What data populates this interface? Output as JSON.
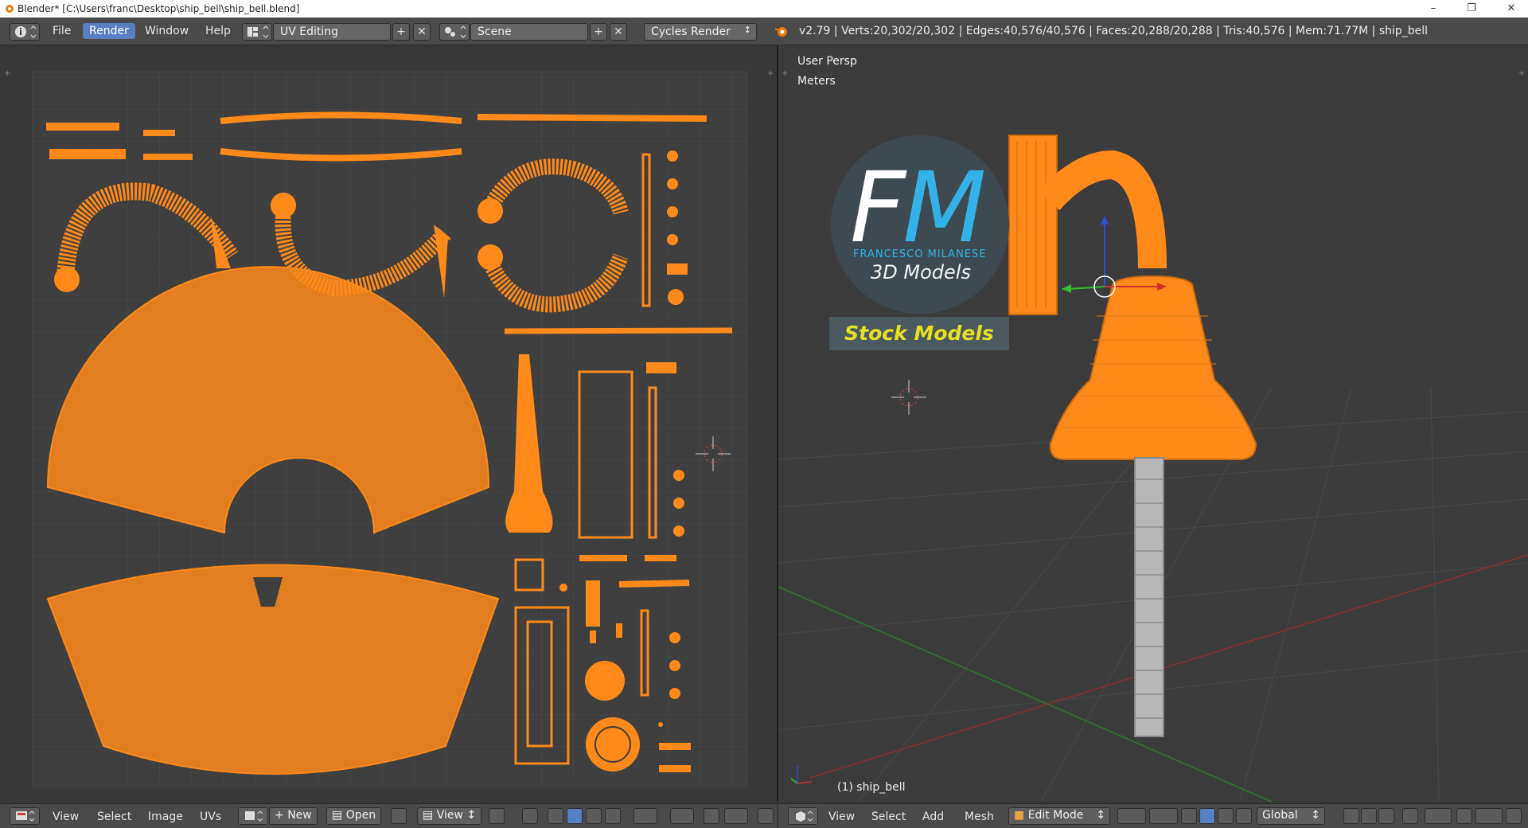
{
  "titlebar": {
    "title": "Blender* [C:\\Users\\franc\\Desktop\\ship_bell\\ship_bell.blend]",
    "icons": [
      "blender-icon",
      "minimize-icon",
      "restore-icon",
      "close-icon"
    ]
  },
  "infobar": {
    "menu": [
      "File",
      "Render",
      "Window",
      "Help"
    ],
    "active_menu": "Render",
    "screen_layout": "UV Editing",
    "scene": "Scene",
    "render_engine": "Cycles Render",
    "stats": "v2.79 | Verts:20,302/20,302 | Edges:40,576/40,576 | Faces:20,288/20,288 | Tris:40,576 | Mem:71.77M | ship_bell"
  },
  "uv_editor": {
    "header_menu": [
      "View",
      "Select",
      "Image",
      "UVs"
    ],
    "new_label": "New",
    "open_label": "Open",
    "view_label": "View"
  },
  "viewport": {
    "view_label": "User Persp",
    "units_label": "Meters",
    "object_label": "(1) ship_bell",
    "header_menu": [
      "View",
      "Select",
      "Add",
      "Mesh"
    ],
    "mode": "Edit Mode",
    "orientation": "Global"
  },
  "logo": {
    "fm": "FM",
    "name": "FRANCESCO MILANESE",
    "models": "3D Models",
    "stock": "Stock Models"
  },
  "colors": {
    "uv_orange": "#ff8a1a",
    "active_blue": "#5680c2",
    "grid": "#4a4a4a",
    "logo_blue": "#33b2e8",
    "logo_yellow": "#e8e020"
  }
}
